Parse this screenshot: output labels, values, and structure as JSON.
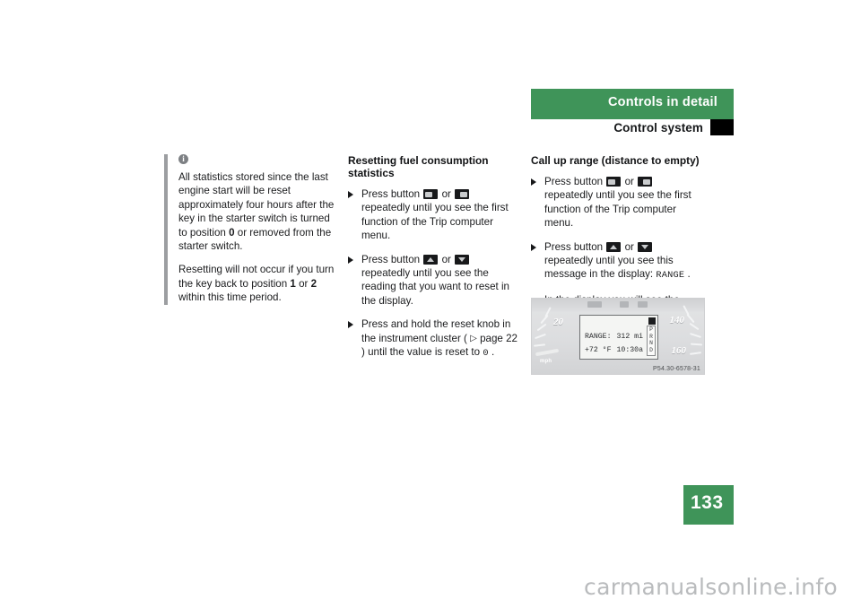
{
  "header": {
    "title": "Controls in detail",
    "subtitle": "Control system",
    "accent_color": "#3f9459",
    "tab_color": "#000000"
  },
  "note": {
    "icon": "info-icon",
    "icon_glyph": "i",
    "paragraphs": [
      "All statistics stored since the last engine start will be reset approximately four hours after the key in the starter switch is turned to position 0 or removed from the starter switch.",
      "Resetting will not occur if you turn the key back to position 1 or 2 within this time period."
    ],
    "paragraph_1_parts": {
      "a": "All statistics stored since the last engine start will be reset approximately four hours after the key in the starter switch is turned to position ",
      "bold_1": "0",
      "b": " or removed from the starter switch."
    },
    "paragraph_2_parts": {
      "a": "Resetting will not occur if you turn the key back to position ",
      "bold_1": "1",
      "b": " or ",
      "bold_2": "2",
      "c": " within this time period."
    }
  },
  "section_reset": {
    "heading": "Resetting fuel consumption statistics",
    "steps": [
      {
        "bullet": true,
        "pre": "Press button",
        "icon_1": "trip-left-button-icon",
        "mid": "or",
        "icon_2": "trip-right-button-icon",
        "post": "repeatedly until you see the first function of the Trip computer menu."
      },
      {
        "bullet": true,
        "pre": "Press button",
        "icon_1": "menu-up-button-icon",
        "mid": "or",
        "icon_2": "menu-down-button-icon",
        "post": "repeatedly until you see the reading that you want to reset in the display."
      },
      {
        "bullet": true,
        "pre": "Press and hold the reset knob in the instrument cluster (",
        "ref_arrow": "▷",
        "ref": " page 22",
        "post": ") until the value is reset to ",
        "mono_value": "0",
        "tail": "."
      }
    ]
  },
  "section_range": {
    "heading": "Call up range (distance to empty)",
    "steps": [
      {
        "bullet": true,
        "pre": "Press button",
        "icon_1": "trip-left-button-icon",
        "mid": "or",
        "icon_2": "trip-right-button-icon",
        "post": "repeatedly until you see the first function of the Trip computer menu."
      },
      {
        "bullet": true,
        "pre": "Press button",
        "icon_1": "menu-up-button-icon",
        "mid": "or",
        "icon_2": "menu-down-button-icon",
        "post": "repeatedly until you see this message in the display: ",
        "mono_value": "RANGE",
        "tail": "."
      },
      {
        "bullet": false,
        "text": "In the display you will see the calculated range based on the current fuel tank level."
      }
    ]
  },
  "figure": {
    "name": "instrument-cluster-illustration",
    "caption": "P54.30-6578-31",
    "speedo_left_label": "20",
    "speedo_left_unit": "mph",
    "speedo_right_label_1": "140",
    "speedo_right_label_2": "160",
    "lcd": {
      "row_1_label": "RANGE:",
      "row_1_value": "312 mi",
      "row_2_label": "+72 °F",
      "row_2_value": "10:30a",
      "gear_indicator": [
        "P",
        "R",
        "N",
        "D"
      ]
    }
  },
  "page_number": "133",
  "watermark": "carmanualsonline.info"
}
